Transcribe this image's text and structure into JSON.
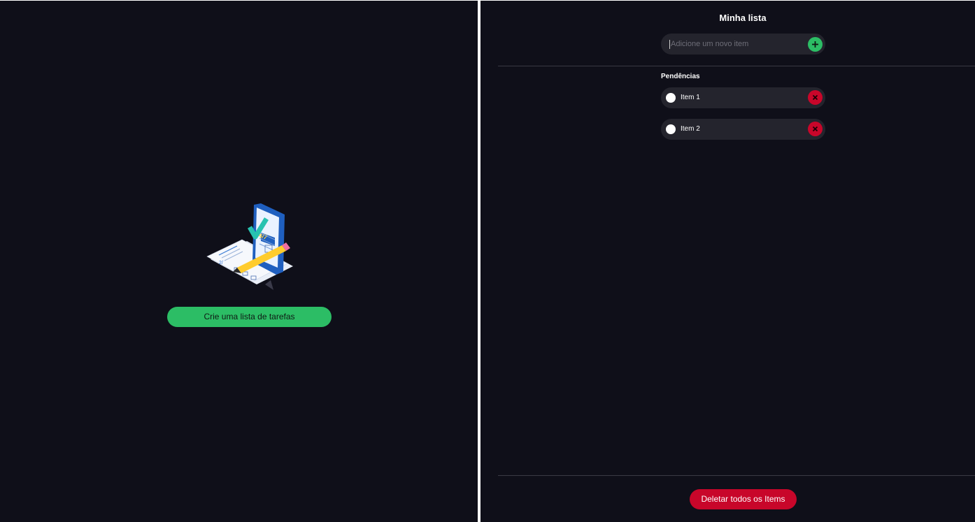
{
  "left": {
    "create_button_label": "Crie uma lista de tarefas"
  },
  "right": {
    "title": "Minha lista",
    "add_input": {
      "placeholder": "Adicione um novo item",
      "value": ""
    },
    "section_label": "Pendências",
    "items": [
      {
        "label": "Item 1"
      },
      {
        "label": "Item 2"
      }
    ],
    "delete_all_label": "Deletar todos os Items"
  },
  "icons": {
    "add": "plus-icon",
    "delete": "close-icon",
    "illustration": "checklist-illustration"
  },
  "colors": {
    "background": "#0f0f19",
    "accent_green": "#2cbd65",
    "danger_red": "#c8062a",
    "surface": "#24242d"
  }
}
